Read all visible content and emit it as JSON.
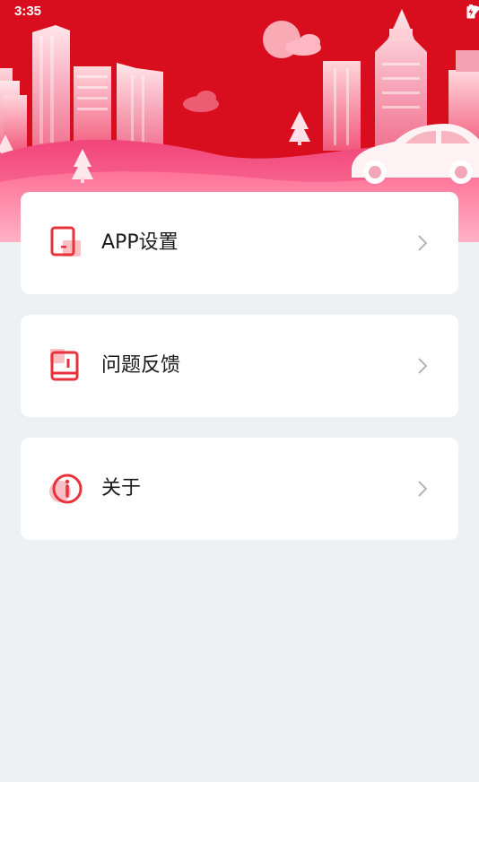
{
  "status_bar": {
    "time": "3:35"
  },
  "colors": {
    "brand_red": "#d80e1e",
    "icon_red": "#e8323c",
    "icon_pink": "#f8c0c4",
    "background": "#edf1f4",
    "chevron": "#b4b4b4"
  },
  "menu": {
    "items": [
      {
        "label": "APP设置",
        "icon": "phone-settings-icon"
      },
      {
        "label": "问题反馈",
        "icon": "feedback-book-icon"
      },
      {
        "label": "关于",
        "icon": "info-icon"
      }
    ]
  }
}
